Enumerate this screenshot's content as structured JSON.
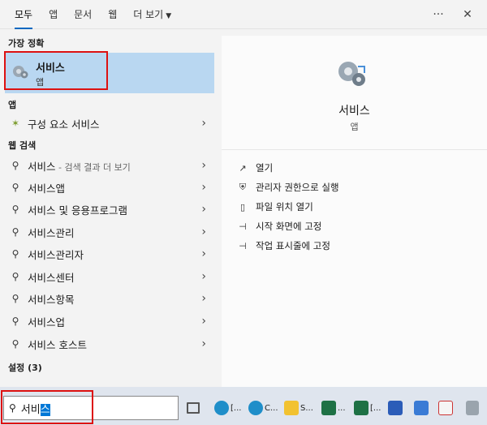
{
  "tabs": [
    {
      "label": "모두",
      "active": true
    },
    {
      "label": "앱"
    },
    {
      "label": "문서"
    },
    {
      "label": "웹"
    },
    {
      "label": "더 보기"
    }
  ],
  "top_actions": {
    "more_label": "···",
    "close_label": "✕"
  },
  "sections": {
    "best_match": "가장 정확",
    "apps": "앱",
    "web": "웹 검색",
    "settings": "설정 (3)"
  },
  "best_match": {
    "name": "서비스",
    "type": "앱"
  },
  "apps": [
    {
      "label": "구성 요소 서비스"
    }
  ],
  "web_results": [
    {
      "label": "서비스",
      "suffix": " - 검색 결과 더 보기"
    },
    {
      "label": "서비스앱"
    },
    {
      "label": "서비스 및 응용프로그램"
    },
    {
      "label": "서비스관리"
    },
    {
      "label": "서비스관리자"
    },
    {
      "label": "서비스센터"
    },
    {
      "label": "서비스항목"
    },
    {
      "label": "서비스업"
    },
    {
      "label": "서비스 호스트"
    }
  ],
  "preview": {
    "title": "서비스",
    "subtitle": "앱",
    "actions": [
      {
        "label": "열기",
        "icon": "open-icon"
      },
      {
        "label": "관리자 권한으로 실행",
        "icon": "admin-shield-icon"
      },
      {
        "label": "파일 위치 열기",
        "icon": "file-location-icon"
      },
      {
        "label": "시작 화면에 고정",
        "icon": "pin-icon"
      },
      {
        "label": "작업 표시줄에 고정",
        "icon": "pin-icon"
      }
    ]
  },
  "search": {
    "typed": "서비",
    "highlighted": "스"
  },
  "taskbar": {
    "items": [
      {
        "label": "",
        "icon": "task-view-icon"
      },
      {
        "label": "[...",
        "icon": "edge-icon"
      },
      {
        "label": "C...",
        "icon": "edge-icon"
      },
      {
        "label": "S...",
        "icon": "file-explorer-icon"
      },
      {
        "label": "...",
        "icon": "excel-icon"
      },
      {
        "label": "[...",
        "icon": "excel-icon"
      },
      {
        "label": "",
        "icon": "store-icon"
      },
      {
        "label": "",
        "icon": "settings-app-icon"
      },
      {
        "label": "",
        "icon": "snipping-tool-icon"
      },
      {
        "label": "",
        "icon": "app-icon"
      }
    ]
  },
  "colors": {
    "accent": "#0067c0",
    "best_match_bg": "#b9d7f1",
    "highlight_outline": "#dd1111",
    "search_selection": "#0078d7"
  }
}
